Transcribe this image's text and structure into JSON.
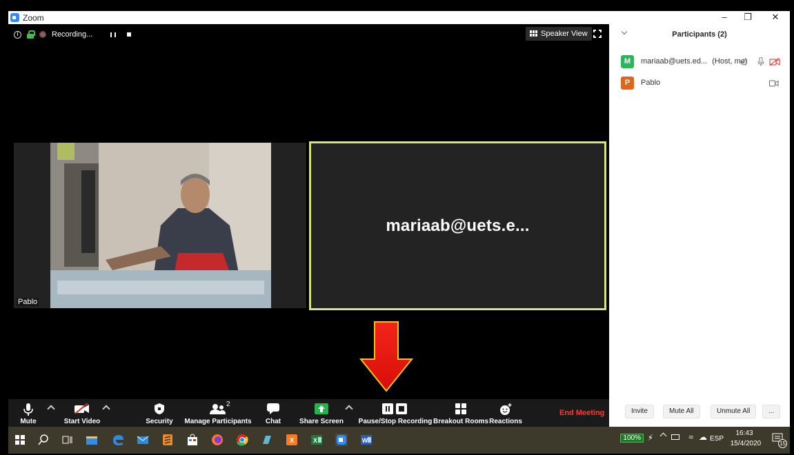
{
  "window": {
    "title": "Zoom",
    "controls": [
      "minimize",
      "restore",
      "close"
    ]
  },
  "meeting": {
    "recording_status": "Recording...",
    "speaker_view_label": "Speaker View",
    "tiles": [
      {
        "name": "Pablo"
      },
      {
        "name": "mariaab@uets.e...",
        "active_speaker": true
      }
    ]
  },
  "toolbar": {
    "mute": "Mute",
    "start_video": "Start Video",
    "security": "Security",
    "manage_participants": "Manage Participants",
    "participant_count": "2",
    "chat": "Chat",
    "share_screen": "Share Screen",
    "pause_stop_recording": "Pause/Stop Recording",
    "breakout_rooms": "Breakout Rooms",
    "reactions": "Reactions",
    "end_meeting": "End Meeting"
  },
  "participants_panel": {
    "title": "Participants (2)",
    "participants": [
      {
        "initial": "M",
        "name": "mariaab@uets.ed...",
        "tag": "(Host, me)",
        "color": "#2eb45c"
      },
      {
        "initial": "P",
        "name": "Pablo",
        "tag": "",
        "color": "#e0661b"
      }
    ],
    "buttons": {
      "invite": "Invite",
      "mute_all": "Mute All",
      "unmute_all": "Unmute All",
      "more": "..."
    }
  },
  "taskbar": {
    "battery": "100%",
    "language": "ESP",
    "time": "16:43",
    "date": "15/4/2020",
    "notifications": "15"
  },
  "colors": {
    "accent": "#2d8cff",
    "active_border": "#d4e87a",
    "end_meeting": "#ff3b30",
    "arrow": "#ee1c0f"
  }
}
